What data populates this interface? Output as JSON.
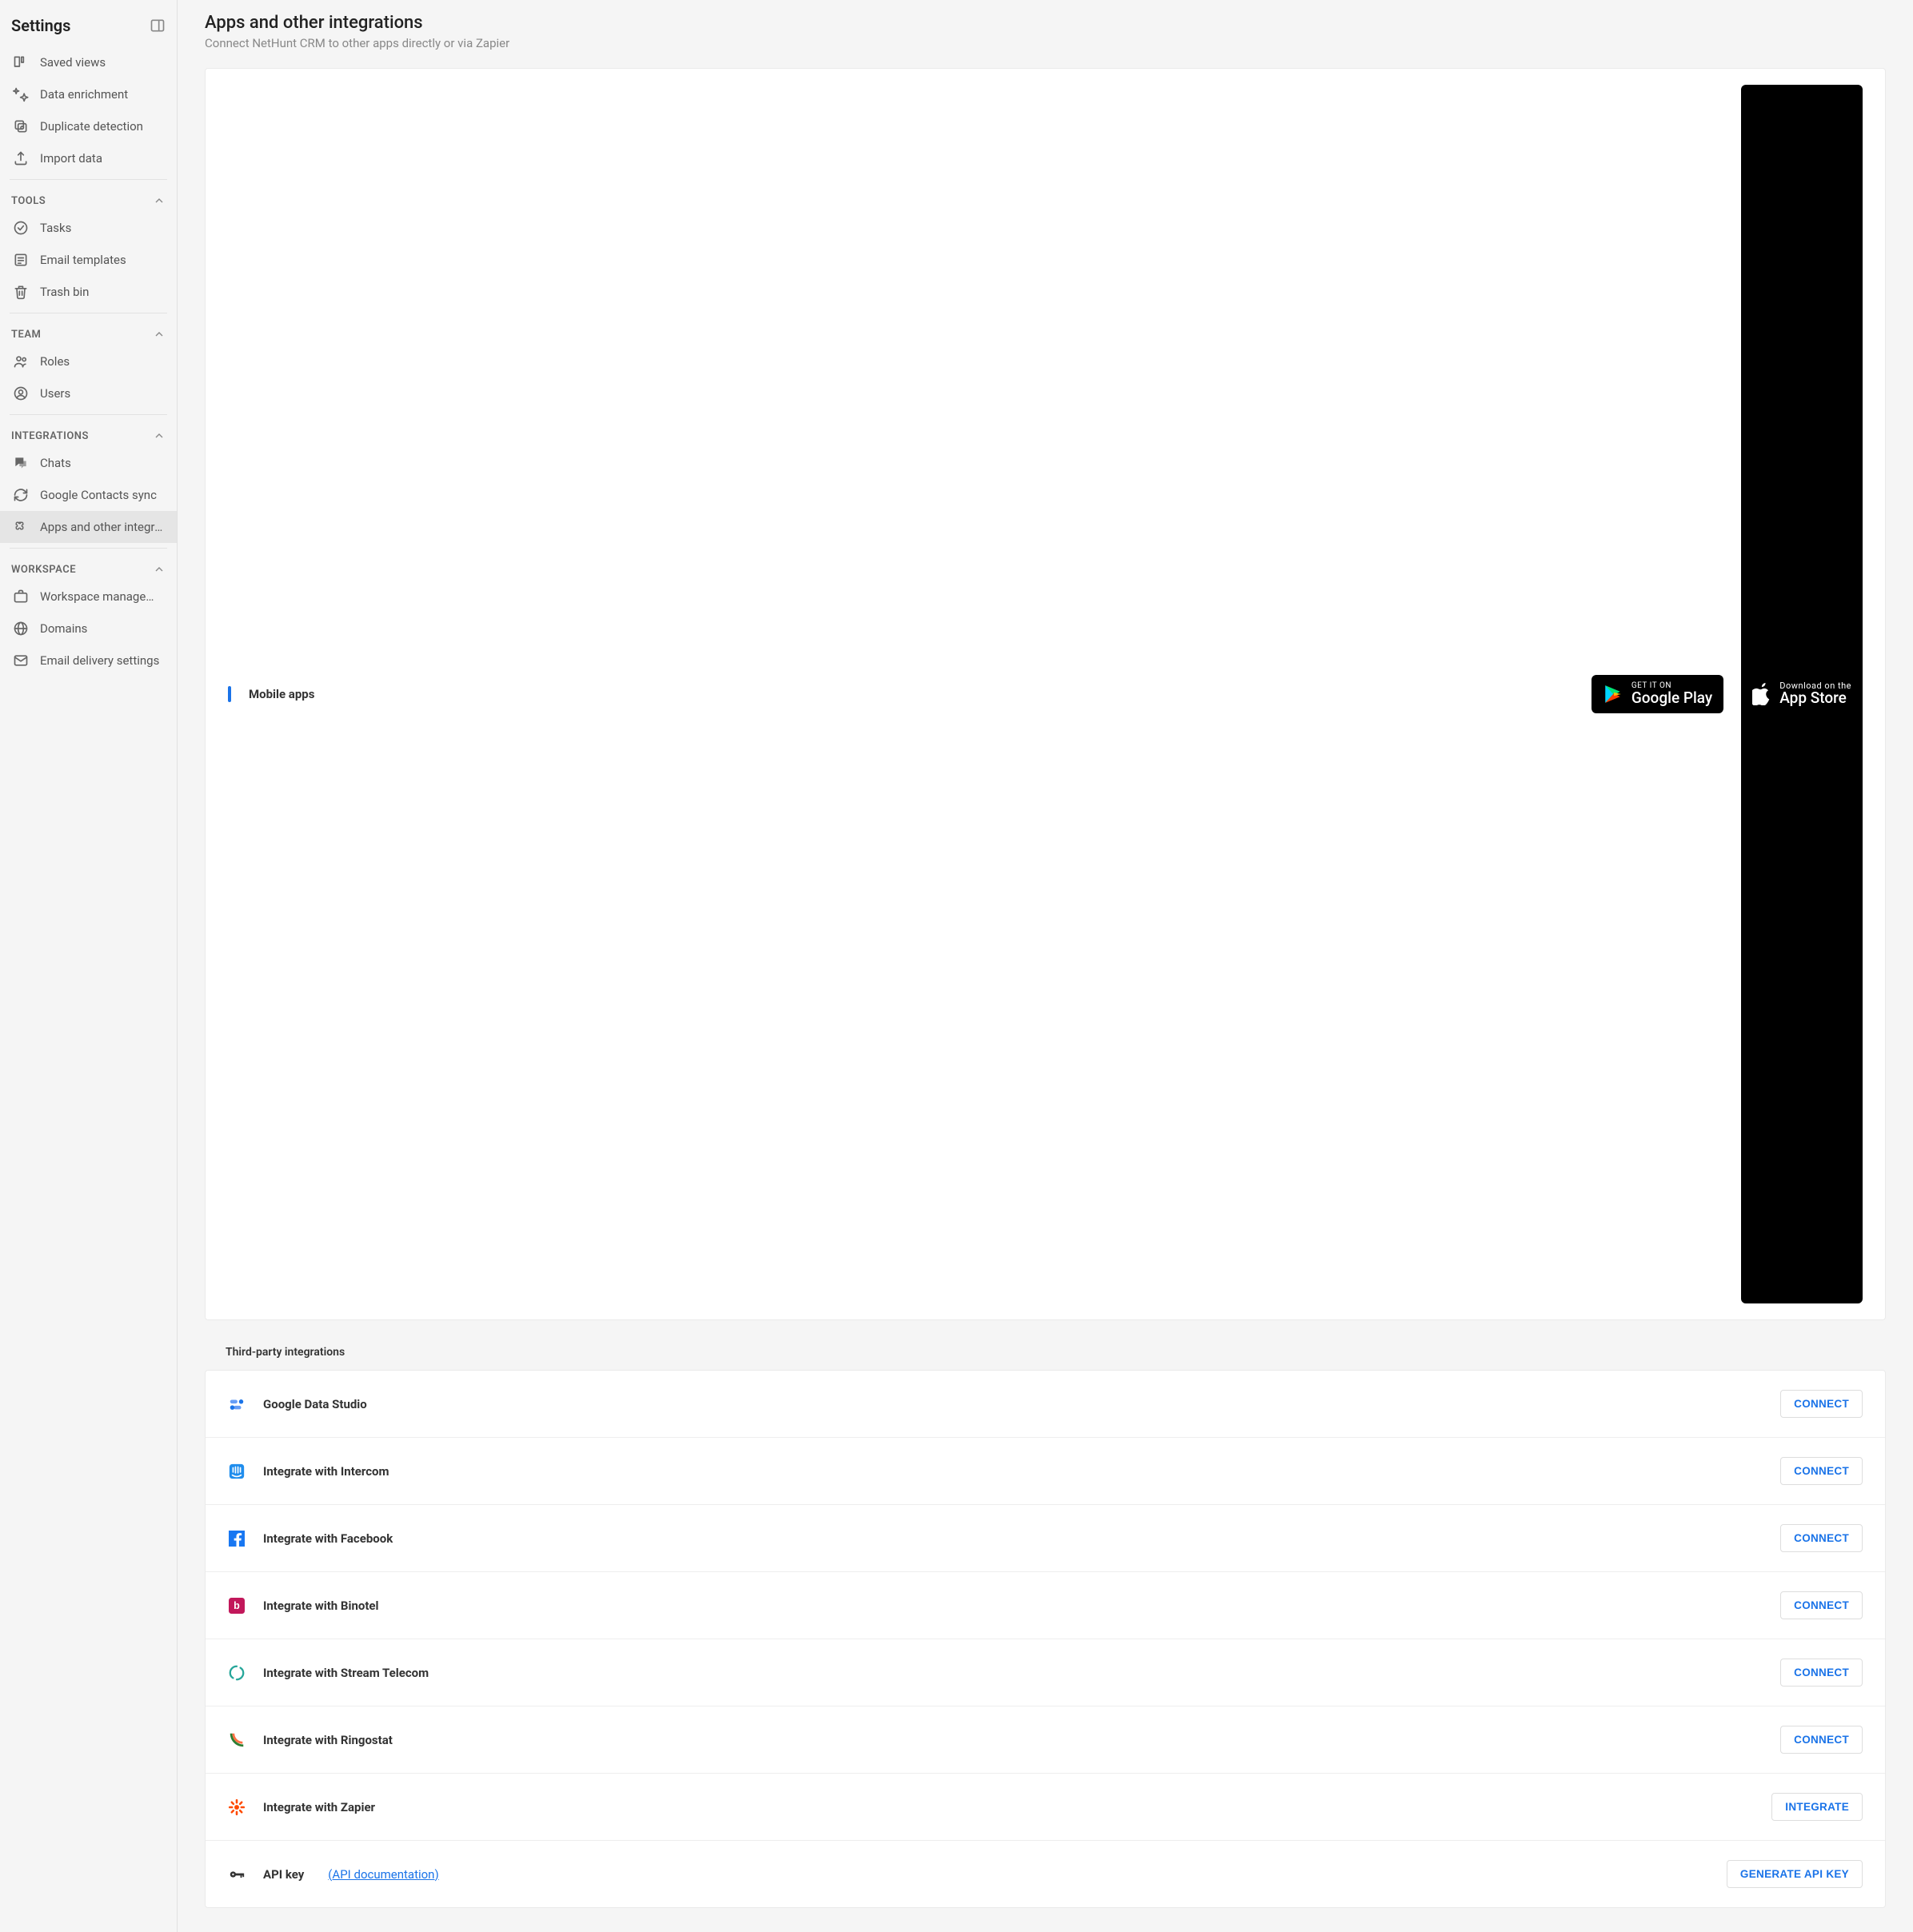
{
  "sidebar": {
    "title": "Settings",
    "groups": [
      {
        "header": null,
        "items": [
          {
            "id": "saved-views",
            "label": "Saved views",
            "icon": "board"
          },
          {
            "id": "data-enrichment",
            "label": "Data enrichment",
            "icon": "sparkle"
          },
          {
            "id": "duplicate-detection",
            "label": "Duplicate detection",
            "icon": "dup"
          },
          {
            "id": "import-data",
            "label": "Import data",
            "icon": "upload"
          }
        ]
      },
      {
        "header": "TOOLS",
        "items": [
          {
            "id": "tasks",
            "label": "Tasks",
            "icon": "check"
          },
          {
            "id": "email-templates",
            "label": "Email templates",
            "icon": "templates"
          },
          {
            "id": "trash-bin",
            "label": "Trash bin",
            "icon": "trash"
          }
        ]
      },
      {
        "header": "TEAM",
        "items": [
          {
            "id": "roles",
            "label": "Roles",
            "icon": "roles"
          },
          {
            "id": "users",
            "label": "Users",
            "icon": "user"
          }
        ]
      },
      {
        "header": "INTEGRATIONS",
        "items": [
          {
            "id": "chats",
            "label": "Chats",
            "icon": "chat"
          },
          {
            "id": "google-contacts-sync",
            "label": "Google Contacts sync",
            "icon": "sync"
          },
          {
            "id": "apps-integrations",
            "label": "Apps and other integra…",
            "icon": "puzzle",
            "active": true
          }
        ]
      },
      {
        "header": "WORKSPACE",
        "items": [
          {
            "id": "workspace-management",
            "label": "Workspace manageme…",
            "icon": "briefcase"
          },
          {
            "id": "domains",
            "label": "Domains",
            "icon": "globe"
          },
          {
            "id": "email-delivery",
            "label": "Email delivery settings",
            "icon": "mailcog"
          }
        ]
      }
    ]
  },
  "page": {
    "title": "Apps and other integrations",
    "subtitle": "Connect NetHunt CRM to other apps directly or via Zapier"
  },
  "mobile": {
    "label": "Mobile apps",
    "google": {
      "small": "GET IT ON",
      "big": "Google Play"
    },
    "apple": {
      "small": "Download on the",
      "big": "App Store"
    }
  },
  "third_party_label": "Third-party integrations",
  "integrations": [
    {
      "id": "gds",
      "name": "Google Data Studio",
      "button": "CONNECT",
      "icon": "gds",
      "color": "#1a73e8"
    },
    {
      "id": "intercom",
      "name": "Integrate with Intercom",
      "button": "CONNECT",
      "icon": "intercom",
      "color": "#1f8ded"
    },
    {
      "id": "facebook",
      "name": "Integrate with Facebook",
      "button": "CONNECT",
      "icon": "facebook",
      "color": "#1877f2"
    },
    {
      "id": "binotel",
      "name": "Integrate with Binotel",
      "button": "CONNECT",
      "icon": "binotel",
      "color": "#c2185b"
    },
    {
      "id": "streamtelecom",
      "name": "Integrate with Stream Telecom",
      "button": "CONNECT",
      "icon": "stream",
      "color": "#26a69a"
    },
    {
      "id": "ringostat",
      "name": "Integrate with Ringostat",
      "button": "CONNECT",
      "icon": "ringostat",
      "color": "#2e7d32"
    },
    {
      "id": "zapier",
      "name": "Integrate with Zapier",
      "button": "INTEGRATE",
      "icon": "zapier",
      "color": "#ff4a00"
    },
    {
      "id": "apikey",
      "name": "API key",
      "button": "GENERATE API KEY",
      "icon": "key",
      "color": "#333",
      "link": "(API documentation)"
    }
  ]
}
